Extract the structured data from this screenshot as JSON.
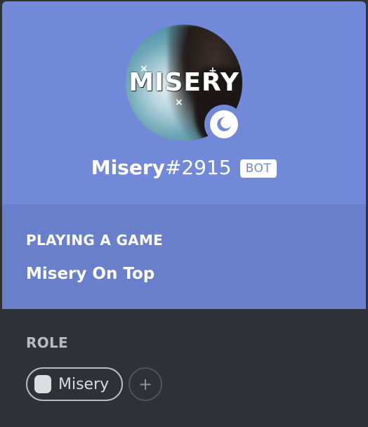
{
  "profile": {
    "avatar_text": "MISERY",
    "username": "Misery",
    "discriminator": "#2915",
    "bot_tag": "BOT",
    "status": "idle-moon-icon"
  },
  "activity": {
    "heading": "PLAYING A GAME",
    "game": "Misery On Top"
  },
  "roles": {
    "heading": "ROLE",
    "items": [
      {
        "label": "Misery",
        "color": "#dcddde"
      }
    ],
    "add_label": "+"
  },
  "colors": {
    "header": "#7289da",
    "activity_bg": "#6a7fcc",
    "body_bg": "#2f3136",
    "text_muted": "#b9bbbe"
  }
}
